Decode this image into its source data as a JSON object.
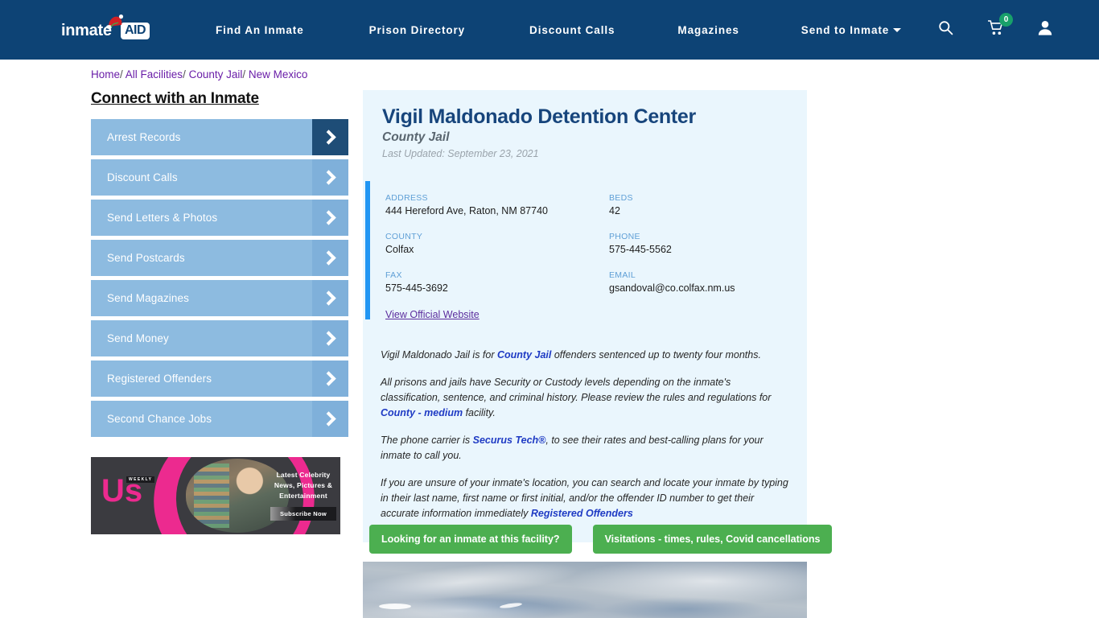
{
  "header": {
    "logo_text": "inmate",
    "logo_badge": "AID",
    "nav": [
      {
        "label": "Find An Inmate"
      },
      {
        "label": "Prison Directory"
      },
      {
        "label": "Discount Calls"
      },
      {
        "label": "Magazines"
      },
      {
        "label": "Send to Inmate"
      }
    ],
    "cart_count": "0",
    "icons": [
      "search-icon",
      "cart-icon",
      "user-icon"
    ],
    "brand_color": "#0d4375"
  },
  "breadcrumb": {
    "items": [
      "Home",
      "All Facilities",
      "County Jail",
      "New Mexico"
    ],
    "separator": "/"
  },
  "sidebar": {
    "title": "Connect with an Inmate",
    "items": [
      {
        "label": "Arrest Records"
      },
      {
        "label": "Discount Calls"
      },
      {
        "label": "Send Letters & Photos"
      },
      {
        "label": "Send Postcards"
      },
      {
        "label": "Send Magazines"
      },
      {
        "label": "Send Money"
      },
      {
        "label": "Registered Offenders"
      },
      {
        "label": "Second Chance Jobs"
      }
    ],
    "ad": {
      "brand": "Us",
      "brand_sub": "WEEKLY",
      "headline": "Latest Celebrity News, Pictures & Entertainment",
      "cta": "Subscribe Now"
    }
  },
  "facility": {
    "name": "Vigil Maldonado Detention Center",
    "type": "County Jail",
    "last_updated": "Last Updated: September 23, 2021",
    "fields": [
      {
        "label": "ADDRESS",
        "value": "444 Hereford Ave, Raton, NM 87740"
      },
      {
        "label": "BEDS",
        "value": "42"
      },
      {
        "label": "COUNTY",
        "value": "Colfax"
      },
      {
        "label": "PHONE",
        "value": "575-445-5562"
      },
      {
        "label": "FAX",
        "value": "575-445-3692"
      },
      {
        "label": "EMAIL",
        "value": "gsandoval@co.colfax.nm.us"
      }
    ],
    "official_website_link": "View Official Website"
  },
  "description": {
    "p1_a": "Vigil Maldonado Jail is for ",
    "p1_link": "County Jail",
    "p1_b": " offenders sentenced up to twenty four months.",
    "p2_a": "All prisons and jails have Security or Custody levels depending on the inmate's classification, sentence, and criminal history. Please review the rules and regulations for ",
    "p2_link": "County - medium",
    "p2_b": " facility.",
    "p3_a": "The phone carrier is ",
    "p3_link": "Securus Tech®",
    "p3_b": ", to see their rates and best-calling plans for your inmate to call you.",
    "p4_a": "If you are unsure of your inmate's location, you can search and locate your inmate by typing in their last name, first name or first initial, and/or the offender ID number to get their accurate information immediately ",
    "p4_link": "Registered Offenders"
  },
  "cta_buttons": [
    {
      "label": "Looking for an inmate at this facility?"
    },
    {
      "label": "Visitations - times, rules, Covid cancellations"
    }
  ],
  "colors": {
    "panel_bg": "#eaf6fd",
    "accent_bar": "#2196f3",
    "cta_green": "#4caf50",
    "sidebar_blue": "#8dbbe0"
  }
}
